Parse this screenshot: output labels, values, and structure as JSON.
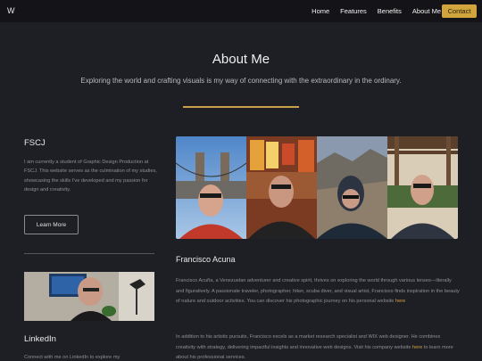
{
  "nav": {
    "logo": "W",
    "links": [
      "Home",
      "Features",
      "Benefits",
      "About Me"
    ],
    "contact": "Contact",
    "accent": "#d2a43c"
  },
  "hero": {
    "title": "About Me",
    "subtitle": "Exploring the world and crafting visuals is my way of connecting with the extraordinary in the ordinary."
  },
  "fscj": {
    "title": "FSCJ",
    "body": "I am currently a student of Graphic Design Production at FSCJ. This website serves as the culmination of my studies, showcasing the skills I've developed and my passion for design and creativity.",
    "button": "Learn More"
  },
  "linkedin": {
    "title": "LinkedIn",
    "body": "Connect with me on LinkedIn to explore my"
  },
  "profile": {
    "name": "Francisco Acuna",
    "bio1": "Francisco Acuña, a Venezuelan adventurer and creative spirit, thrives on exploring the world through various lenses—literally and figuratively. A passionate traveler, photographer, hiker, scuba diver, and visual artist, Francisco finds inspiration in the beauty of nature and outdoor activities. You can discover his photographic journey on his personal website",
    "bio1_link": "here",
    "bio2": "In addition to his artistic pursuits, Francisco excels as a market research specialist and WIX web designer. He combines creativity with strategy, delivering impactful insights and innovative web designs. Visit his company website",
    "bio2_link": "here",
    "bio2_end": "to learn more about his professional services."
  }
}
